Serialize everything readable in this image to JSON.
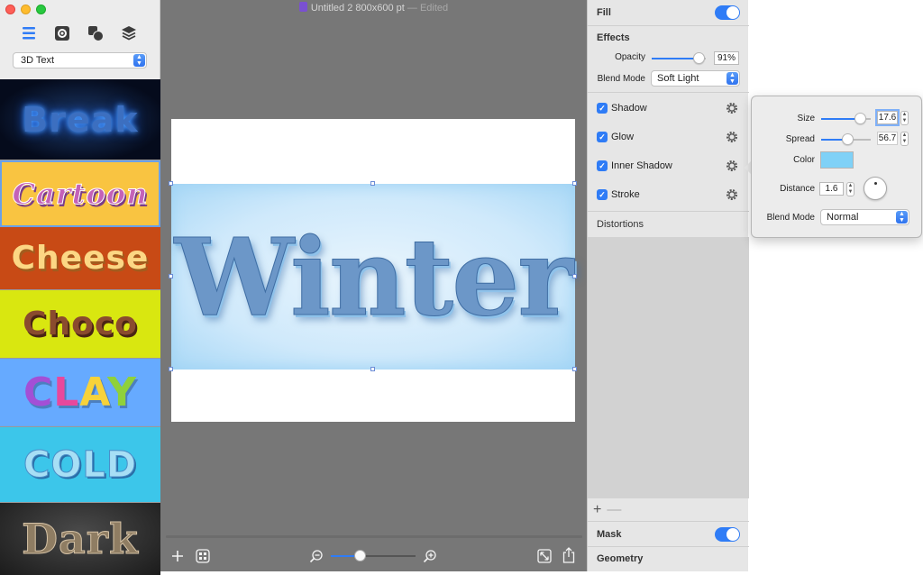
{
  "window": {
    "title": "Untitled 2 800x600 pt",
    "edited": "— Edited"
  },
  "sidebar": {
    "tools": [
      {
        "icon": "list-icon"
      },
      {
        "icon": "gear-box-icon"
      },
      {
        "icon": "shapes-icon"
      },
      {
        "icon": "layers-icon"
      }
    ],
    "category": "3D Text",
    "styles": [
      {
        "label": "Break"
      },
      {
        "label": "Cartoon"
      },
      {
        "label": "Cheese"
      },
      {
        "label": "Choco"
      },
      {
        "label": "CLAY"
      },
      {
        "label": "COLD"
      },
      {
        "label": "Dark"
      }
    ]
  },
  "canvas": {
    "text": "Winter"
  },
  "inspector": {
    "fill": {
      "label": "Fill",
      "enabled": true
    },
    "effects": {
      "label": "Effects",
      "opacity_label": "Opacity",
      "opacity_value": "91%",
      "opacity": 0.91,
      "blend_mode_label": "Blend Mode",
      "blend_mode_value": "Soft Light",
      "items": [
        {
          "label": "Shadow",
          "checked": true
        },
        {
          "label": "Glow",
          "checked": true
        },
        {
          "label": "Inner Shadow",
          "checked": true
        },
        {
          "label": "Stroke",
          "checked": true
        }
      ]
    },
    "distortions": {
      "label": "Distortions"
    },
    "mask": {
      "label": "Mask",
      "enabled": true
    },
    "geometry": {
      "label": "Geometry"
    }
  },
  "popover": {
    "size_label": "Size",
    "size_value": "17.6",
    "spread_label": "Spread",
    "spread_value": "56.7",
    "color_label": "Color",
    "color_value": "#7fd1f7",
    "distance_label": "Distance",
    "distance_value": "1.6",
    "blend_mode_label": "Blend Mode",
    "blend_mode_value": "Normal"
  },
  "colors": {
    "accent": "#2f7cf6",
    "canvas_bg": "#777777",
    "inspector_bg": "#e6e6e6"
  }
}
